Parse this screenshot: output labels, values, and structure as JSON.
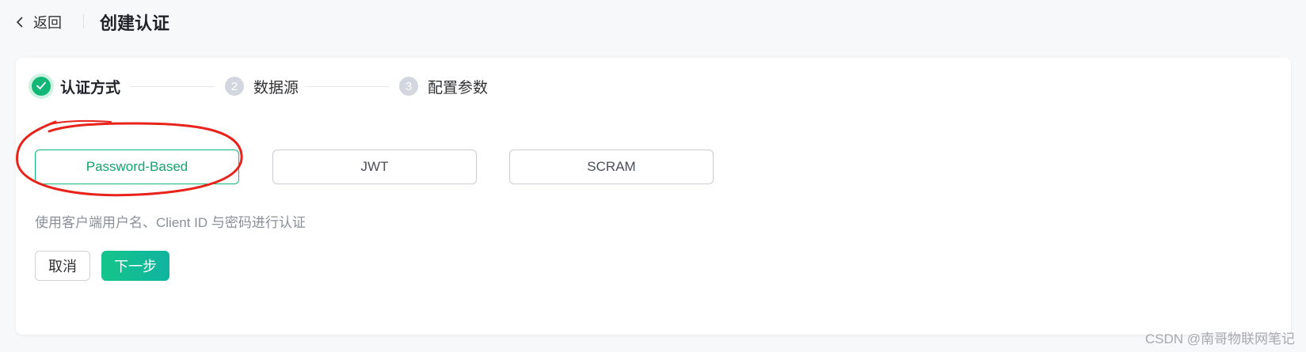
{
  "header": {
    "back_label": "返回",
    "title": "创建认证"
  },
  "steps": [
    {
      "number": "",
      "label": "认证方式",
      "status": "done"
    },
    {
      "number": "2",
      "label": "数据源",
      "status": "pending"
    },
    {
      "number": "3",
      "label": "配置参数",
      "status": "pending"
    }
  ],
  "auth_options": [
    {
      "label": "Password-Based",
      "selected": true
    },
    {
      "label": "JWT",
      "selected": false
    },
    {
      "label": "SCRAM",
      "selected": false
    }
  ],
  "description": "使用客户端用户名、Client ID 与密码进行认证",
  "buttons": {
    "cancel": "取消",
    "next": "下一步"
  },
  "watermark": "CSDN @南哥物联网笔记",
  "colors": {
    "accent": "#12b776",
    "annotation": "#e8231b"
  },
  "icons": {
    "back": "chevron-left-icon",
    "step_done": "check-icon"
  }
}
